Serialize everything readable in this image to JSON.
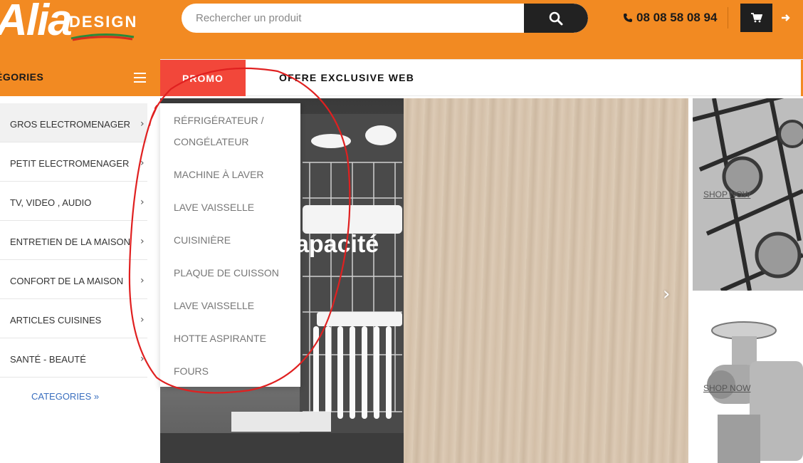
{
  "header": {
    "logo_text": "Alia",
    "logo_sub": "DESIGN",
    "search_placeholder": "Rechercher un produit",
    "phone": "08 08 58 08 94",
    "icons": {
      "search": "search-icon",
      "phone": "phone-icon",
      "cart": "cart-icon",
      "exit": "arrow-right-icon"
    }
  },
  "catbar": {
    "title": "ÉGORIES"
  },
  "nav": {
    "promo_label": "PROMO",
    "offer_label": "OFFRE EXCLUSIVE WEB"
  },
  "sidebar": {
    "items": [
      {
        "label": "GROS ELECTROMENAGER",
        "chevron": "›"
      },
      {
        "label": "PETIT ELECTROMENAGER",
        "chevron": "›"
      },
      {
        "label": "TV, VIDEO , AUDIO",
        "chevron": "›"
      },
      {
        "label": "ENTRETIEN DE LA MAISON",
        "chevron": "›"
      },
      {
        "label": "CONFORT DE LA MAISON",
        "chevron": "›"
      },
      {
        "label": "ARTICLES CUISINES",
        "chevron": "›"
      },
      {
        "label": "SANTÉ - BEAUTÉ",
        "chevron": "›"
      }
    ],
    "footer_label": "CATEGORIES »"
  },
  "dropdown": {
    "items": [
      "RÉFRIGÉRATEUR / CONGÉLATEUR",
      "MACHINE À LAVER",
      "LAVE VAISSELLE",
      "CUISINIÈRE",
      "PLAQUE DE CUISSON",
      "LAVE VAISSELLE",
      "HOTTE ASPIRANTE",
      "FOURS"
    ]
  },
  "banner": {
    "text": "apacité",
    "next": "›"
  },
  "tiles": {
    "shop_now": "SHOP NOW"
  },
  "colors": {
    "brand_orange": "#f28a22",
    "promo_red": "#f2473a",
    "dark": "#222222",
    "link_blue": "#3a6fbf"
  }
}
